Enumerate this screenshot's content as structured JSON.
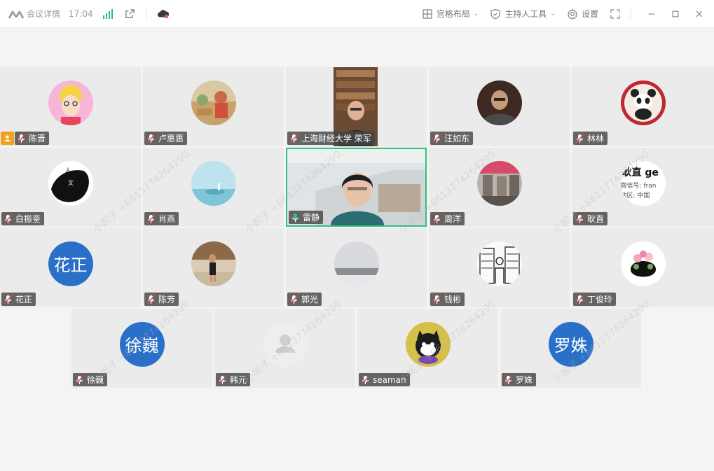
{
  "titlebar": {
    "meeting_info_label": "会议详情",
    "time": "17:04",
    "grid_layout_label": "宫格布局",
    "host_tools_label": "主持人工具",
    "settings_label": "设置"
  },
  "watermark": "小妮子 +8613774264290",
  "participants": [
    {
      "name": "陈晋",
      "kind": "photo",
      "host": true
    },
    {
      "name": "卢惠惠",
      "kind": "photo"
    },
    {
      "name": "上海财经大学 荣军",
      "kind": "video"
    },
    {
      "name": "汪如东",
      "kind": "photo"
    },
    {
      "name": "林林",
      "kind": "photo"
    },
    {
      "name": "白振奎",
      "kind": "photo"
    },
    {
      "name": "肖燕",
      "kind": "photo"
    },
    {
      "name": "雷静",
      "kind": "video",
      "speaking": true
    },
    {
      "name": "周洋",
      "kind": "photo"
    },
    {
      "name": "耿直",
      "kind": "photo",
      "avatar_text": [
        "耿直 ge",
        "微信号: fran",
        "地区: 中国"
      ]
    },
    {
      "name": "花正",
      "kind": "text",
      "avatar_text": "花正"
    },
    {
      "name": "陈芳",
      "kind": "photo"
    },
    {
      "name": "郭光",
      "kind": "photo"
    },
    {
      "name": "钱彬",
      "kind": "photo"
    },
    {
      "name": "丁俊玲",
      "kind": "photo"
    },
    {
      "name": "徐巍",
      "kind": "text",
      "avatar_text": "徐巍"
    },
    {
      "name": "韩元",
      "kind": "default"
    },
    {
      "name": "seaman",
      "kind": "photo"
    },
    {
      "name": "罗姝",
      "kind": "text",
      "avatar_text": "罗姝"
    }
  ],
  "colors": {
    "accent_green": "#31c27c",
    "text_avatar_blue": "#2a70c9",
    "host_badge_orange": "#f3a020"
  }
}
